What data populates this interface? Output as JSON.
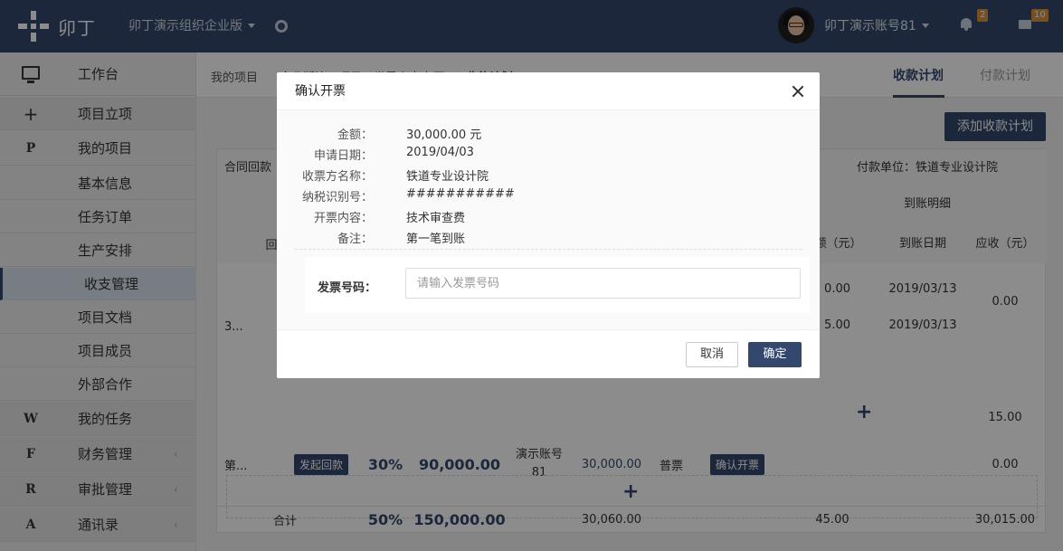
{
  "header": {
    "logo_text": "卯丁",
    "org_name": "卯丁演示组织企业版",
    "account_name": "卯丁演示账号81",
    "notifications_count": "2",
    "messages_count": "10"
  },
  "sidebar": {
    "items": [
      {
        "icon": "monitor-icon",
        "label": "工作台"
      },
      {
        "icon": "+",
        "label": "项目立项"
      },
      {
        "icon": "P",
        "label": "我的项目"
      },
      {
        "icon": "",
        "label": "基本信息"
      },
      {
        "icon": "",
        "label": "任务订单"
      },
      {
        "icon": "",
        "label": "生产安排"
      },
      {
        "icon": "",
        "label": "收支管理"
      },
      {
        "icon": "",
        "label": "项目文档"
      },
      {
        "icon": "",
        "label": "项目成员"
      },
      {
        "icon": "",
        "label": "外部合作"
      },
      {
        "icon": "W",
        "label": "我的任务"
      },
      {
        "icon": "F",
        "label": "财务管理"
      },
      {
        "icon": "R",
        "label": "审批管理"
      },
      {
        "icon": "A",
        "label": "通讯录"
      }
    ]
  },
  "breadcrumb": {
    "items": [
      "我的项目",
      "企业版演示项目",
      "世界之大大厦",
      "收款计划"
    ]
  },
  "tabs": {
    "receive": "收款计划",
    "pay": "付款计划"
  },
  "add_plan_button": "添加收款计划",
  "table": {
    "h_contract": "合同回款",
    "h_payer": "付款单位：铁道专业设计院",
    "h_arrival": "到账明细",
    "h_huikuan": "回",
    "h_amount": "金额（元）",
    "h_date": "到账日期",
    "h_receivable": "应收（元）",
    "row1_name": "3...",
    "row1_amt1": "0.00",
    "row1_date1": "2019/03/13",
    "row1_amt2": "5.00",
    "row1_date2": "2019/03/13",
    "row1_receivable": "0.00",
    "row1_receivable2": "15.00",
    "row2_name": "第...",
    "row2_button": "发起回款",
    "row2_percent": "30%",
    "row2_amount": "90,000.00",
    "row2_account": "演示账号81",
    "row2_invoice_amount": "30,000.00",
    "row2_invoice_type": "普票",
    "row2_confirm": "确认开票",
    "row2_receivable": "0.00",
    "total_label": "合计",
    "total_percent": "50%",
    "total_amount": "150,000.00",
    "total_invoice": "30,060.00",
    "total_arrived": "45.00",
    "total_receivable": "30,015.00"
  },
  "modal": {
    "title": "确认开票",
    "fields": [
      {
        "label": "金额：",
        "value": "30,000.00 元"
      },
      {
        "label": "申请日期：",
        "value": "2019/04/03"
      },
      {
        "label": "收票方名称：",
        "value": "铁道专业设计院"
      },
      {
        "label": "纳税识别号：",
        "value": "###########"
      },
      {
        "label": "开票内容：",
        "value": "技术审查费"
      },
      {
        "label": "备注：",
        "value": "第一笔到账"
      }
    ],
    "invoice_label": "发票号码：",
    "invoice_placeholder": "请输入发票号码",
    "invoice_value": "",
    "cancel": "取消",
    "confirm": "确定"
  }
}
